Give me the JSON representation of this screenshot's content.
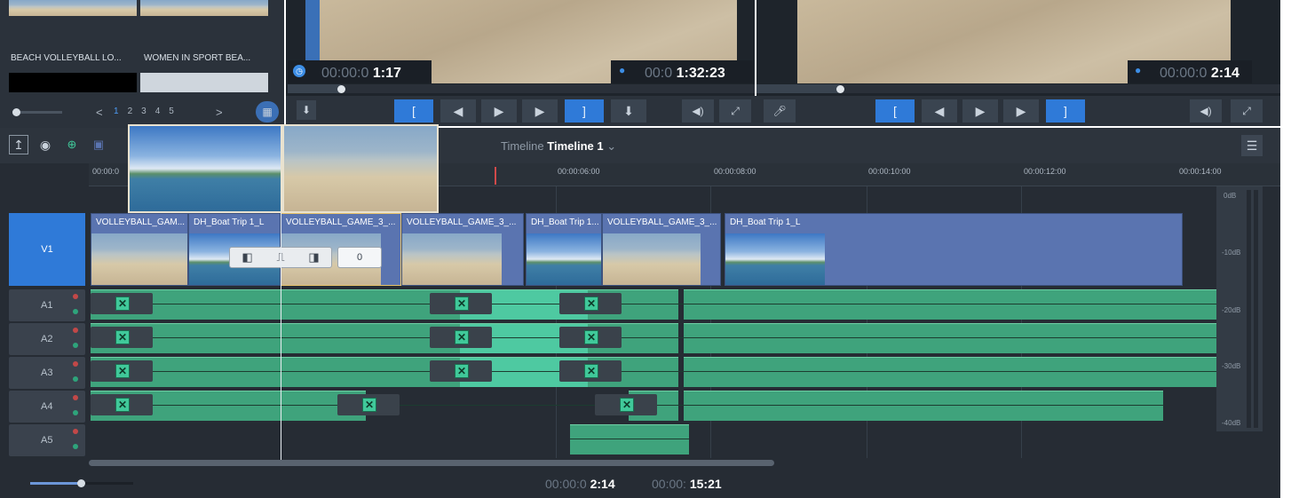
{
  "bin": {
    "items": [
      {
        "label": "BEACH VOLLEYBALL LO..."
      },
      {
        "label": "WOMEN IN SPORT BEA..."
      }
    ],
    "pages": [
      "1",
      "2",
      "3",
      "4",
      "5"
    ],
    "prev": "<",
    "next": ">"
  },
  "source": {
    "timecode_dim": "00:00:0",
    "timecode_bright": "1:17"
  },
  "record": {
    "timecode_dim": "00:0",
    "timecode_bright": "1:32:23"
  },
  "program": {
    "timecode_dim": "00:00:0",
    "timecode_bright": "2:14"
  },
  "timeline": {
    "label": "Timeline",
    "name": "Timeline 1"
  },
  "ruler": [
    "00:00:0",
    "00:00:06:00",
    "00:00:08:00",
    "00:00:10:00",
    "00:00:12:00",
    "00:00:14:00"
  ],
  "tracks": {
    "video": "V1",
    "audio": [
      "A1",
      "A2",
      "A3",
      "A4",
      "A5"
    ]
  },
  "clips": [
    {
      "label": "VOLLEYBALL_GAM..."
    },
    {
      "label": "DH_Boat Trip 1_L"
    },
    {
      "label": "VOLLEYBALL_GAME_3_..."
    },
    {
      "label": "VOLLEYBALL_GAME_3_..."
    },
    {
      "label": "DH_Boat Trip 1..."
    },
    {
      "label": "VOLLEYBALL_GAME_3_..."
    },
    {
      "label": "DH_Boat Trip 1_L"
    }
  ],
  "transition": {
    "value": "0"
  },
  "meter": {
    "ticks": [
      "0dB",
      "-10dB",
      "-20dB",
      "-30dB",
      "-40dB"
    ]
  },
  "footer": {
    "tc1_dim": "00:00:0",
    "tc1_bright": "2:14",
    "tc2_dim": "00:00:",
    "tc2_bright": "15:21"
  },
  "colors": {
    "accent": "#2f7ad8",
    "audio": "#3fa37c",
    "video": "#5a74b0"
  }
}
